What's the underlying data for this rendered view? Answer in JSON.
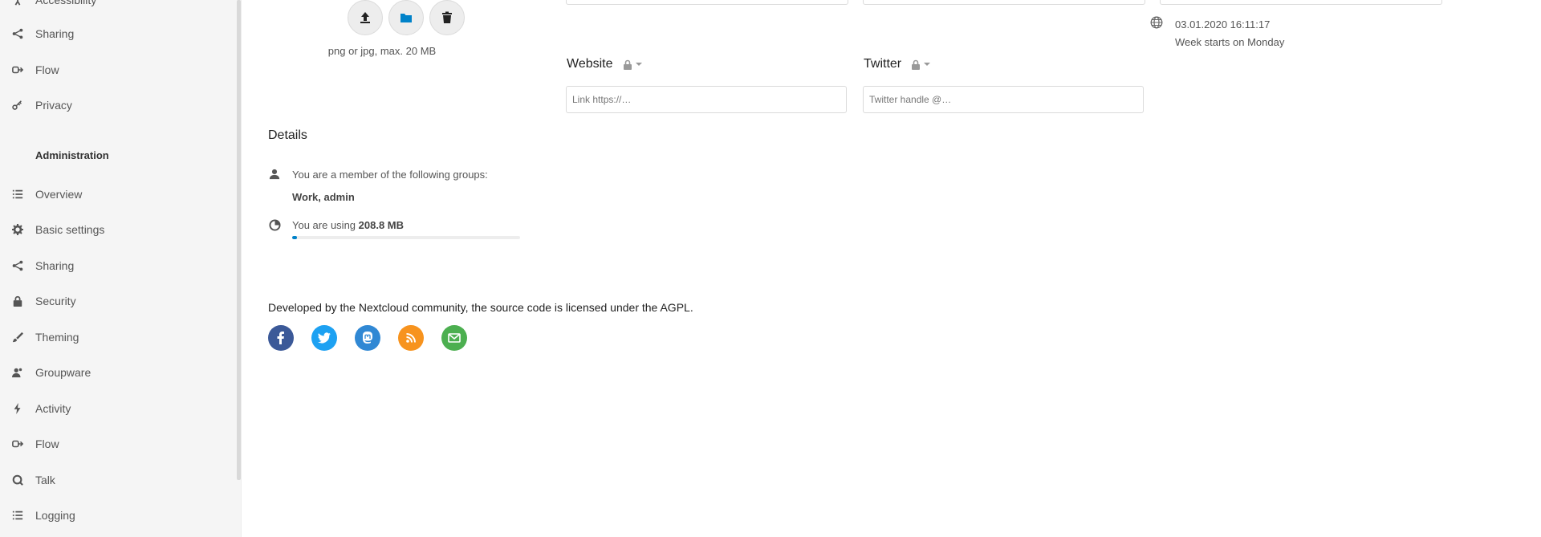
{
  "sidebar": {
    "personal_items": [
      {
        "label": "Accessibility",
        "icon": "accessibility-icon"
      },
      {
        "label": "Sharing",
        "icon": "share-icon"
      },
      {
        "label": "Flow",
        "icon": "flow-icon"
      },
      {
        "label": "Privacy",
        "icon": "key-icon"
      }
    ],
    "admin_heading": "Administration",
    "admin_items": [
      {
        "label": "Overview",
        "icon": "list-icon"
      },
      {
        "label": "Basic settings",
        "icon": "gear-icon"
      },
      {
        "label": "Sharing",
        "icon": "share-icon"
      },
      {
        "label": "Security",
        "icon": "lock-icon"
      },
      {
        "label": "Theming",
        "icon": "paint-icon"
      },
      {
        "label": "Groupware",
        "icon": "groupware-icon"
      },
      {
        "label": "Activity",
        "icon": "lightning-icon"
      },
      {
        "label": "Flow",
        "icon": "flow-icon"
      },
      {
        "label": "Talk",
        "icon": "talk-icon"
      },
      {
        "label": "Logging",
        "icon": "list-icon"
      }
    ]
  },
  "avatar": {
    "upload_icon": "upload-icon",
    "files_icon": "folder-icon",
    "delete_icon": "trash-icon",
    "hint": "png or jpg, max. 20 MB"
  },
  "profile": {
    "website_label": "Website",
    "website_placeholder": "Link https://…",
    "twitter_label": "Twitter",
    "twitter_placeholder": "Twitter handle @…"
  },
  "locale": {
    "datetime": "03.01.2020 16:11:17",
    "week_start": "Week starts on Monday"
  },
  "details": {
    "title": "Details",
    "groups_text": "You are a member of the following groups:",
    "groups_value": "Work, admin",
    "usage_prefix": "You are using",
    "usage_value": "208.8 MB",
    "usage_fraction": 0.02
  },
  "footer": {
    "text": "Developed by the Nextcloud community, the source code is licensed under the AGPL.",
    "social": [
      {
        "name": "facebook-icon",
        "color": "#3b5998"
      },
      {
        "name": "twitter-icon",
        "color": "#1da1f2"
      },
      {
        "name": "mastodon-icon",
        "color": "#3088d4"
      },
      {
        "name": "rss-icon",
        "color": "#f7931e"
      },
      {
        "name": "mail-icon",
        "color": "#4caf50"
      }
    ]
  },
  "colors": {
    "accent": "#0082c9"
  }
}
